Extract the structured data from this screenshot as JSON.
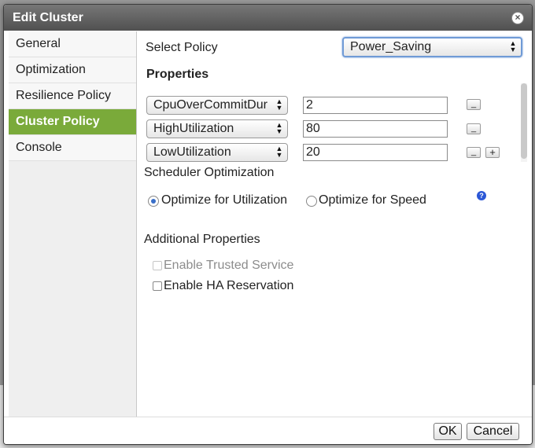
{
  "window": {
    "title": "Edit Cluster"
  },
  "sidebar": {
    "items": [
      {
        "label": "General"
      },
      {
        "label": "Optimization"
      },
      {
        "label": "Resilience Policy"
      },
      {
        "label": "Cluster Policy",
        "active": true
      },
      {
        "label": "Console"
      }
    ]
  },
  "policy": {
    "label": "Select Policy",
    "selected": "Power_Saving"
  },
  "properties": {
    "heading": "Properties",
    "rows": [
      {
        "key": "CpuOverCommitDur",
        "value": "2"
      },
      {
        "key": "HighUtilization",
        "value": "80"
      },
      {
        "key": "LowUtilization",
        "value": "20"
      }
    ]
  },
  "scheduler": {
    "heading": "Scheduler Optimization",
    "options": [
      {
        "label": "Optimize for Utilization",
        "checked": true
      },
      {
        "label": "Optimize for Speed",
        "checked": false
      }
    ]
  },
  "additional": {
    "heading": "Additional Properties",
    "trusted_service": {
      "label": "Enable Trusted Service",
      "disabled": true,
      "checked": false
    },
    "ha_reservation": {
      "label": "Enable HA Reservation",
      "checked": false
    }
  },
  "footer": {
    "ok": "OK",
    "cancel": "Cancel"
  },
  "colors": {
    "active_nav": "#7aaa3a",
    "titlebar": "#5a5a5a",
    "focus": "#6f9ad6"
  },
  "icons": {
    "close": "close-icon",
    "help": "help-icon",
    "remove": "minus-icon",
    "add": "plus-icon"
  }
}
